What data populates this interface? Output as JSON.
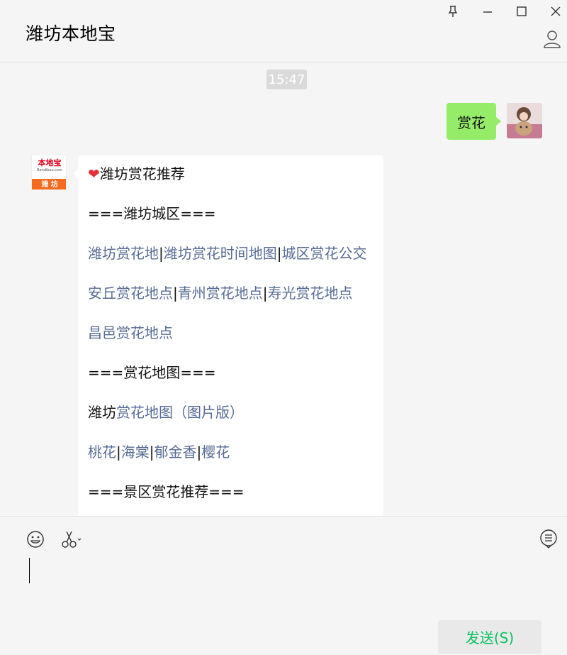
{
  "window": {
    "title": "潍坊本地宝"
  },
  "conversation": {
    "timestamp": "15:47",
    "outgoing": {
      "text": "赏花"
    },
    "bot_avatar": {
      "logo_text": "本地宝",
      "logo_domain": "Bendibao.com",
      "city": "潍 坊"
    },
    "incoming": {
      "title_icon": "heart-icon",
      "title": "潍坊赏花推荐",
      "section1": "===潍坊城区===",
      "row1": [
        "潍坊赏花地",
        "潍坊赏花时间地图",
        "城区赏花公交"
      ],
      "row2": [
        "安丘赏花地点",
        "青州赏花地点",
        "寿光赏花地点"
      ],
      "row3": "昌邑赏花地点",
      "section2": "===赏花地图===",
      "map_prefix": "潍坊",
      "map_link": "赏花地图（图片版）",
      "row4": [
        "桃花",
        "海棠",
        "郁金香",
        "樱花"
      ],
      "section3": "===景区赏花推荐===",
      "separator": "|"
    }
  },
  "composer": {
    "send_label": "发送(S)"
  },
  "colors": {
    "link": "#576b95",
    "outgoing_bubble": "#95ec69",
    "send_text": "#07c160"
  }
}
